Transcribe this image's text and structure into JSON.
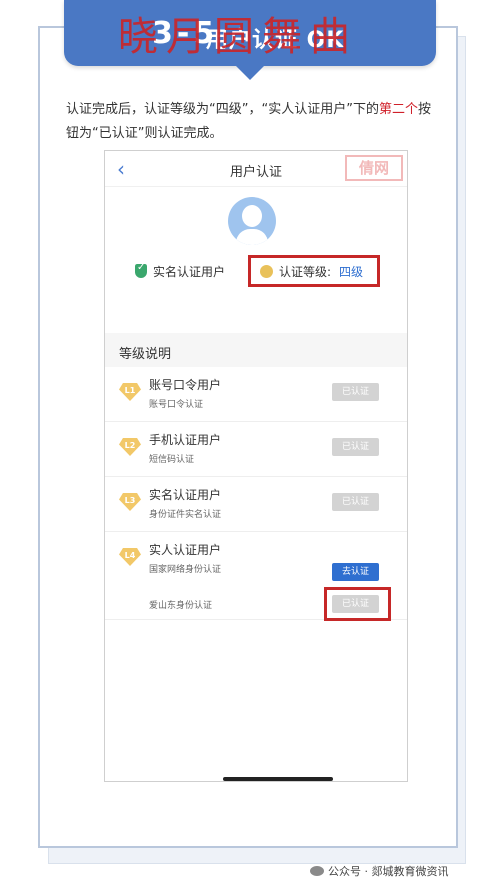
{
  "banner": {
    "step": "3-5",
    "title": "用户认证 OK",
    "watermark": "晓月圆舞曲"
  },
  "desc": {
    "part1": "认证完成后，认证等级为“四级”，“实人认证用户”下的",
    "highlight": "第二个",
    "part2": "按钮为“已认证”则认证完成。"
  },
  "app": {
    "back_icon": "chevron-left-icon",
    "nav_title": "用户认证",
    "nav_watermark": "倩网",
    "status_label": "实名认证用户",
    "level_label": "认证等级:",
    "level_value": "四级",
    "section_title": "等级说明",
    "levels": [
      {
        "badge": "L1",
        "title": "账号口令用户",
        "sub": "账号口令认证",
        "button": "已认证"
      },
      {
        "badge": "L2",
        "title": "手机认证用户",
        "sub": "短信码认证",
        "button": "已认证"
      },
      {
        "badge": "L3",
        "title": "实名认证用户",
        "sub": "身份证件实名认证",
        "button": "已认证"
      },
      {
        "badge": "L4",
        "title": "实人认证用户",
        "sub": "国家网络身份认证",
        "button": "去认证",
        "sub2": "爱山东身份认证",
        "button2": "已认证"
      }
    ]
  },
  "footer": {
    "text": "公众号 · 郯城教育微资讯"
  },
  "colors": {
    "accent": "#4a78c4",
    "highlight": "#c62828",
    "link": "#2f6fd0"
  }
}
